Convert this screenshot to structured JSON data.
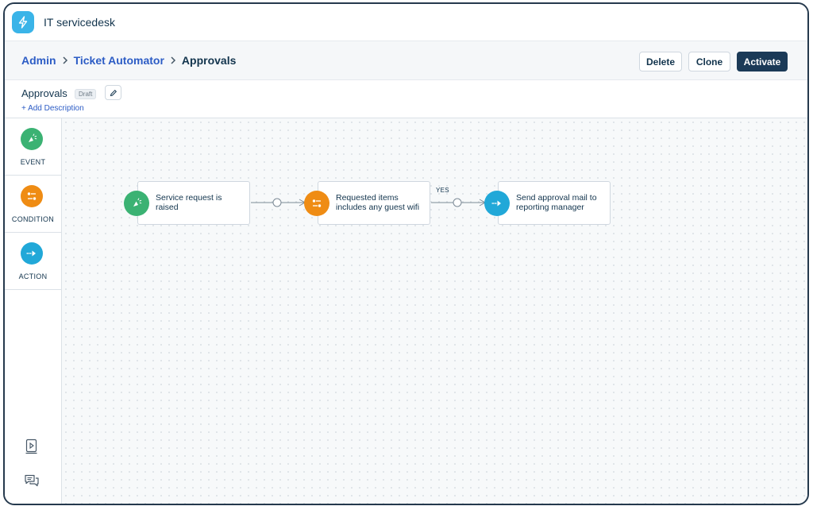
{
  "app": {
    "title": "IT servicedesk",
    "logo_icon": "lightning-bolt-icon",
    "accent": "#3ab4e8"
  },
  "breadcrumb": {
    "items": [
      {
        "label": "Admin"
      },
      {
        "label": "Ticket Automator"
      },
      {
        "label": "Approvals"
      }
    ]
  },
  "actions": {
    "delete_label": "Delete",
    "clone_label": "Clone",
    "activate_label": "Activate"
  },
  "workflow": {
    "name": "Approvals",
    "status": "Draft",
    "add_description": "+ Add Description"
  },
  "palette": {
    "items": [
      {
        "label": "EVENT",
        "icon": "event-icon",
        "color": "#3bb273"
      },
      {
        "label": "CONDITION",
        "icon": "condition-icon",
        "color": "#ef8c14"
      },
      {
        "label": "ACTION",
        "icon": "action-icon",
        "color": "#21a8d8"
      }
    ],
    "tools": [
      {
        "icon": "video-guide-icon"
      },
      {
        "icon": "chat-icon"
      }
    ]
  },
  "flow": {
    "nodes": [
      {
        "type": "event",
        "text": "Service request is raised"
      },
      {
        "type": "condition",
        "text": "Requested items includes any guest wifi"
      },
      {
        "type": "action",
        "text": "Send approval mail to reporting manager"
      }
    ],
    "branch_label": "YES"
  }
}
